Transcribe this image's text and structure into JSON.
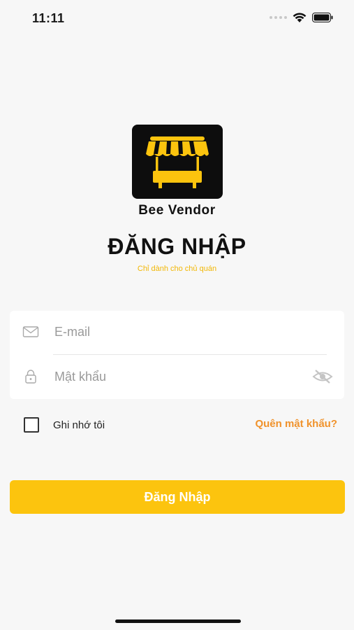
{
  "status_bar": {
    "time": "11:11"
  },
  "brand": {
    "name": "Bee Vendor"
  },
  "page": {
    "title": "ĐĂNG NHẬP",
    "subtitle": "Chỉ dành cho chủ quán"
  },
  "form": {
    "email": {
      "placeholder": "E-mail",
      "value": ""
    },
    "password": {
      "placeholder": "Mật khẩu",
      "value": ""
    }
  },
  "remember": {
    "label": "Ghi nhớ tôi",
    "checked": false
  },
  "forgot": {
    "label": "Quên mật khẩu?"
  },
  "login_button": {
    "label": "Đăng Nhập"
  },
  "colors": {
    "accent": "#fcc40e",
    "link": "#f0922b",
    "subtitle": "#f2b705",
    "background": "#f7f7f7"
  },
  "icons": {
    "email": "envelope-icon",
    "password": "lock-icon",
    "visibility": "eye-slash-icon",
    "logo": "market-stall-icon"
  }
}
